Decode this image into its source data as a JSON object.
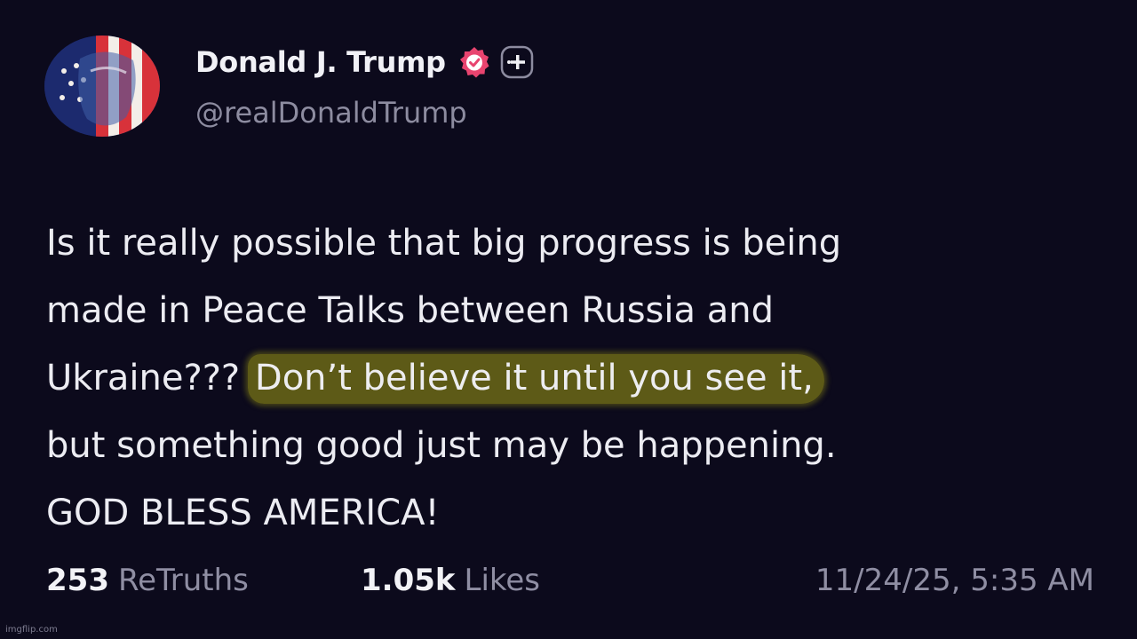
{
  "author": {
    "display_name": "Donald J. Trump",
    "handle": "@realDonaldTrump"
  },
  "post": {
    "line1": "Is it really possible that big progress is being",
    "line2": "made in Peace Talks between Russia and",
    "line3_pre": "Ukraine??? ",
    "line3_highlight": "Don’t believe it until you see it,",
    "line4": "but something good just may be happening.",
    "line5": "GOD BLESS AMERICA!"
  },
  "stats": {
    "retruths_count": "253",
    "retruths_label": "ReTruths",
    "likes_count": "1.05k",
    "likes_label": "Likes",
    "timestamp": "11/24/25, 5:35 AM"
  },
  "watermark": "imgflip.com",
  "icons": {
    "verified": "verified-badge-icon",
    "follow": "follow-plus-icon"
  },
  "colors": {
    "background": "#0c0a1c",
    "highlight": "#5d5a17",
    "verified_badge": "#e8446f",
    "muted_text": "#8f8ea3"
  }
}
